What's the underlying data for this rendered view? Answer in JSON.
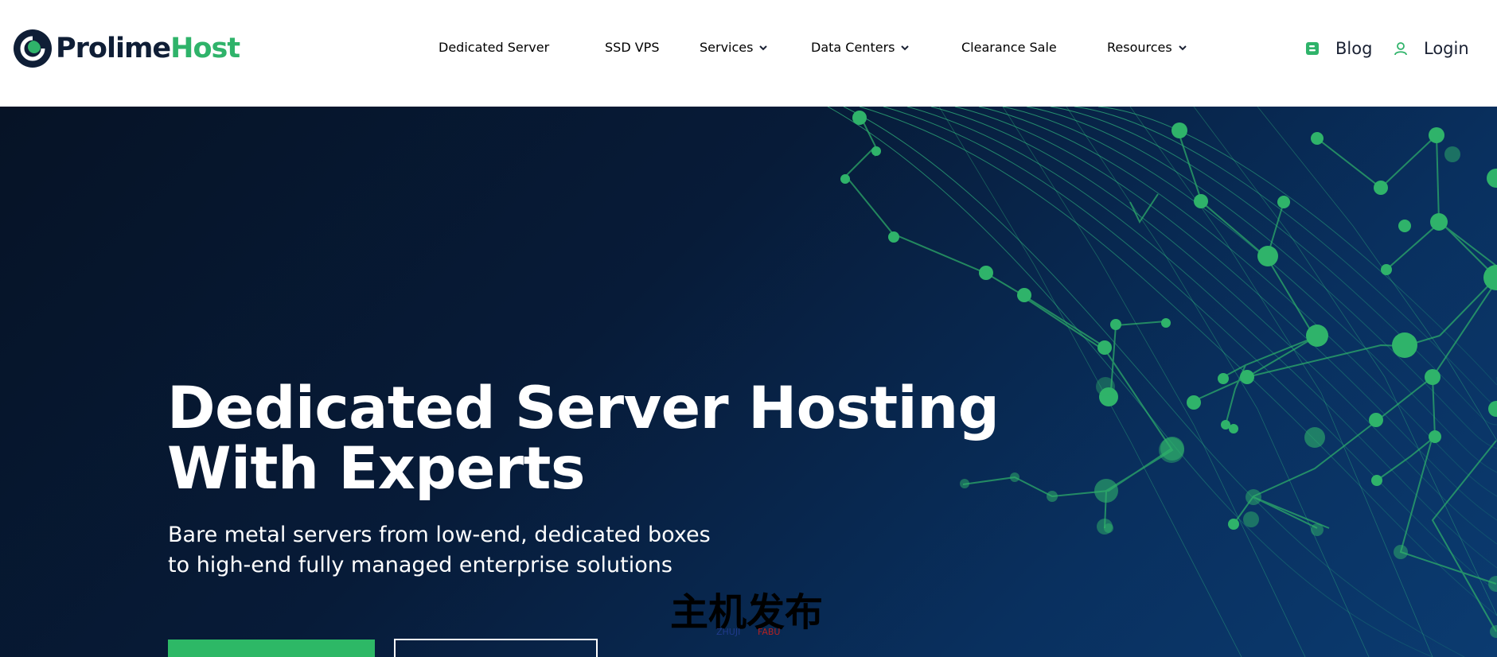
{
  "brand": {
    "name_part1": "Prolime",
    "name_part2": "Host",
    "colors": {
      "navy": "#0f1e36",
      "green": "#2fb36a"
    }
  },
  "nav": {
    "items": [
      {
        "label": "Dedicated Server",
        "has_dropdown": false
      },
      {
        "label": "SSD VPS",
        "has_dropdown": false
      },
      {
        "label": "Services",
        "has_dropdown": true
      },
      {
        "label": "Data Centers",
        "has_dropdown": true
      },
      {
        "label": "Clearance Sale",
        "has_dropdown": false
      },
      {
        "label": "Resources",
        "has_dropdown": true
      }
    ],
    "blog": {
      "label": "Blog",
      "icon": "blogger-icon"
    },
    "login": {
      "label": "Login",
      "icon": "user-icon"
    }
  },
  "hero": {
    "title_line1": "Dedicated Server Hosting",
    "title_line2": "With Experts",
    "subtitle_line1": "Bare metal servers from low-end, dedicated boxes",
    "subtitle_line2": "to high-end fully managed enterprise solutions",
    "accent_color": "#2db866"
  },
  "watermark": {
    "chinese": "主机发布",
    "latin_1": "ZHUJI",
    "latin_2": "FABU"
  }
}
